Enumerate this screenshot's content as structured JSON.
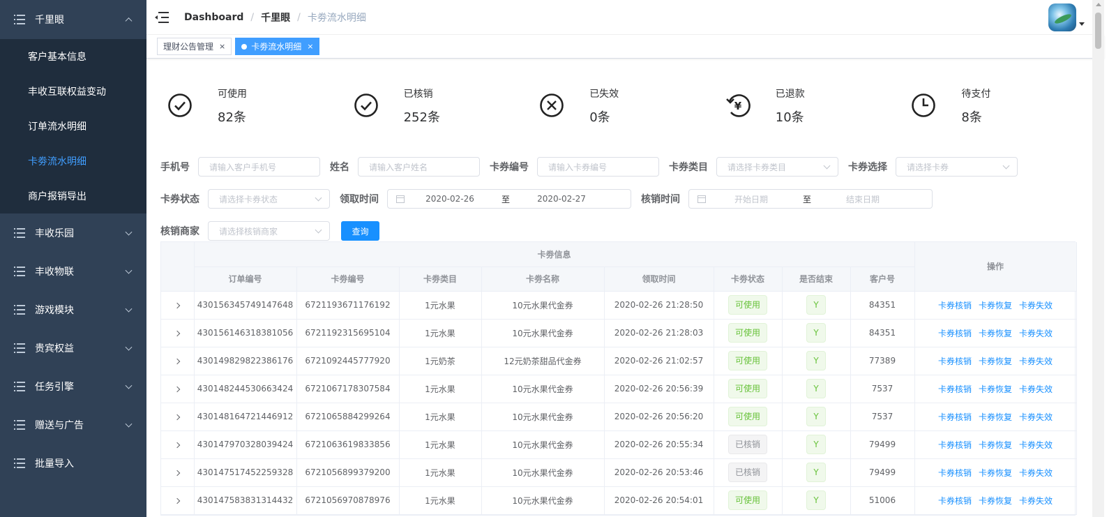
{
  "sidebar": {
    "top_group": "千里眼",
    "sub_items": [
      {
        "label": "客户基本信息",
        "active": false
      },
      {
        "label": "丰收互联权益变动",
        "active": false
      },
      {
        "label": "订单流水明细",
        "active": false
      },
      {
        "label": "卡劵流水明细",
        "active": true
      },
      {
        "label": "商户报销导出",
        "active": false
      }
    ],
    "groups": [
      "丰收乐园",
      "丰收物联",
      "游戏模块",
      "贵宾权益",
      "任务引擎",
      "赠送与广告",
      "批量导入"
    ]
  },
  "breadcrumb": [
    "Dashboard",
    "千里眼",
    "卡劵流水明细"
  ],
  "tags": [
    {
      "label": "理财公告管理",
      "active": false
    },
    {
      "label": "卡劵流水明细",
      "active": true
    }
  ],
  "stats": [
    {
      "label": "可使用",
      "value": "82条",
      "icon": "check-circle-icon"
    },
    {
      "label": "已核销",
      "value": "252条",
      "icon": "check-circle-icon"
    },
    {
      "label": "已失效",
      "value": "0条",
      "icon": "close-circle-icon"
    },
    {
      "label": "已退款",
      "value": "10条",
      "icon": "refund-yen-icon"
    },
    {
      "label": "待支付",
      "value": "8条",
      "icon": "clock-icon"
    }
  ],
  "filters": {
    "phone_label": "手机号",
    "phone_placeholder": "请输入客户手机号",
    "name_label": "姓名",
    "name_placeholder": "请输入客户姓名",
    "code_label": "卡券编号",
    "code_placeholder": "请输入卡券编号",
    "category_label": "卡券类目",
    "category_placeholder": "请选择卡券类目",
    "select_label": "卡券选择",
    "select_placeholder": "请选择卡券",
    "status_label": "卡券状态",
    "status_placeholder": "请选择卡券状态",
    "receive_label": "领取时间",
    "receive_start": "2020-02-26",
    "receive_to": "至",
    "receive_end": "2020-02-27",
    "verify_label": "核销时间",
    "verify_start": "开始日期",
    "verify_to": "至",
    "verify_end": "结束日期",
    "merchant_label": "核销商家",
    "merchant_placeholder": "请选择核销商家",
    "query_button": "查询"
  },
  "table": {
    "group_header": "卡劵信息",
    "columns": [
      "订单编号",
      "卡劵编号",
      "卡劵类目",
      "卡劵名称",
      "领取时间",
      "卡劵状态",
      "是否结束",
      "客户号"
    ],
    "op_header": "操作",
    "ops": [
      "卡券核销",
      "卡券恢复",
      "卡券失效"
    ],
    "rows": [
      {
        "order": "430156345749147648",
        "code": "6721193671176192",
        "cat": "1元水果",
        "name": "10元水果代金券",
        "time": "2020-02-26 21:28:50",
        "status": "可使用",
        "ended": "Y",
        "cust": "84351"
      },
      {
        "order": "430156146318381056",
        "code": "6721192315695104",
        "cat": "1元水果",
        "name": "10元水果代金券",
        "time": "2020-02-26 21:28:03",
        "status": "可使用",
        "ended": "Y",
        "cust": "84351"
      },
      {
        "order": "430149829822386176",
        "code": "6721092445777920",
        "cat": "1元奶茶",
        "name": "12元奶茶甜品代金券",
        "time": "2020-02-26 21:02:57",
        "status": "可使用",
        "ended": "Y",
        "cust": "77389"
      },
      {
        "order": "430148244530663424",
        "code": "6721067178307584",
        "cat": "1元水果",
        "name": "10元水果代金券",
        "time": "2020-02-26 20:56:39",
        "status": "可使用",
        "ended": "Y",
        "cust": "7537"
      },
      {
        "order": "430148164721446912",
        "code": "6721065884299264",
        "cat": "1元水果",
        "name": "10元水果代金券",
        "time": "2020-02-26 20:56:20",
        "status": "可使用",
        "ended": "Y",
        "cust": "7537"
      },
      {
        "order": "430147970328039424",
        "code": "6721063619833856",
        "cat": "1元水果",
        "name": "10元水果代金券",
        "time": "2020-02-26 20:55:34",
        "status": "已核销",
        "ended": "Y",
        "cust": "79499"
      },
      {
        "order": "430147517452259328",
        "code": "6721056899379200",
        "cat": "1元水果",
        "name": "10元水果代金券",
        "time": "2020-02-26 20:53:46",
        "status": "已核销",
        "ended": "Y",
        "cust": "79499"
      },
      {
        "order": "430147583831314432",
        "code": "6721056970878976",
        "cat": "1元水果",
        "name": "10元水果代金券",
        "time": "2020-02-26 20:54:01",
        "status": "可使用",
        "ended": "Y",
        "cust": "51006"
      }
    ]
  }
}
